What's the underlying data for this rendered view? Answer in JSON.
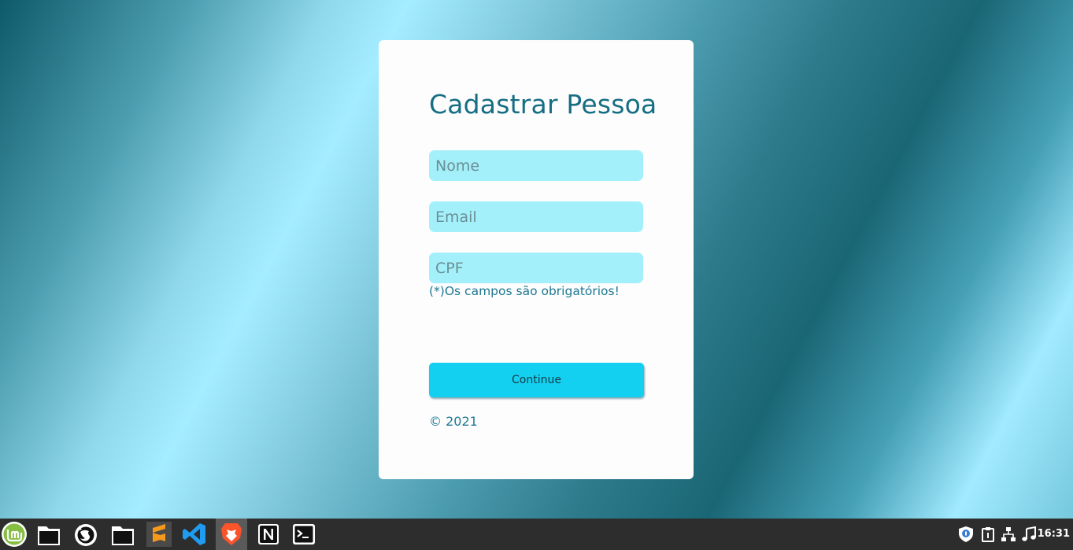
{
  "form": {
    "title": "Cadastrar Pessoa",
    "name_placeholder": "Nome",
    "email_placeholder": "Email",
    "cpf_placeholder": "CPF",
    "required_note": "(*)Os campos são obrigatórios!",
    "continue_label": "Continue",
    "copyright": "© 2021"
  },
  "taskbar": {
    "apps": [
      {
        "icon": "linux-mint-menu-icon"
      },
      {
        "icon": "file-manager-icon"
      },
      {
        "icon": "firefox-icon"
      },
      {
        "icon": "folder-icon"
      },
      {
        "icon": "sublime-text-icon"
      },
      {
        "icon": "vscode-icon"
      },
      {
        "icon": "brave-browser-icon",
        "active": true
      },
      {
        "icon": "notion-icon"
      },
      {
        "icon": "terminal-icon"
      }
    ],
    "tray": [
      "shield-update-icon",
      "clipboard-icon",
      "network-icon",
      "sound-icon"
    ],
    "clock": "16:31"
  },
  "colors": {
    "accent": "#13cff0",
    "title": "#166e83",
    "field_bg": "#a4f0fa",
    "taskbar": "#2d2d2d"
  }
}
